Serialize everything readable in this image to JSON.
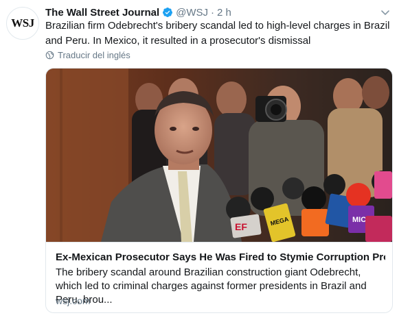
{
  "tweet": {
    "avatar_text": "WSJ",
    "name": "The Wall Street Journal",
    "handle": "@WSJ",
    "separator": "·",
    "time": "2 h",
    "text": "Brazilian firm Odebrecht's bribery scandal led to high-level charges in Brazil and Peru. In Mexico, it resulted in a prosecutor's dismissal",
    "translate_label": "Traducir del inglés"
  },
  "card": {
    "title": "Ex-Mexican Prosecutor Says He Was Fired to Stymie Corruption Probe",
    "description": "The bribery scandal around Brazilian construction giant Odebrecht, which led to criminal charges against former presidents in Brazil and Peru, brou...",
    "domain": "wsj.com",
    "mic_labels": {
      "mic1": "EF",
      "mic2": "MEGA",
      "mic3": "MIC"
    }
  },
  "icons": {
    "verified": "verified-badge-icon",
    "globe": "globe-icon",
    "chevron": "chevron-down-icon"
  },
  "colors": {
    "verified_blue": "#1da1f2",
    "text_primary": "#14171a",
    "text_secondary": "#657786",
    "border": "#e1e8ed"
  }
}
